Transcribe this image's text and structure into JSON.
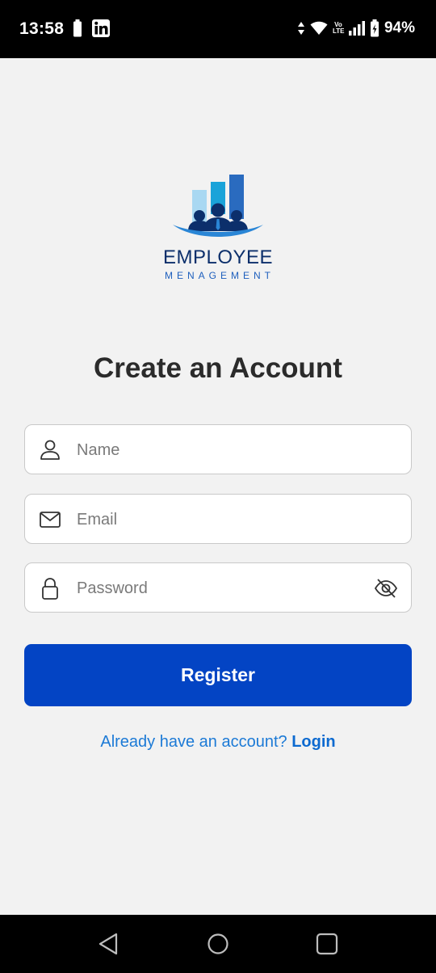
{
  "status_bar": {
    "time": "13:58",
    "battery_percent": "94%",
    "left_icons": [
      "battery-small-icon",
      "linkedin-icon"
    ],
    "right_icons": [
      "data-arrows-icon",
      "wifi-icon",
      "volte-icon",
      "signal-icon",
      "battery-icon"
    ],
    "volte_label": "Vo LTE"
  },
  "logo": {
    "word": "EMPLOYEE",
    "sub": "MENAGEMENT",
    "colors": {
      "dark": "#0c2f6b",
      "light_bar": "#a9d8f2",
      "mid_bar": "#1aa3d9",
      "tall_bar": "#2a6bbf",
      "swoosh": "#2a86d6"
    }
  },
  "page": {
    "title": "Create an Account"
  },
  "form": {
    "name": {
      "placeholder": "Name",
      "value": "",
      "icon": "person-icon"
    },
    "email": {
      "placeholder": "Email",
      "value": "",
      "icon": "mail-icon"
    },
    "password": {
      "placeholder": "Password",
      "value": "",
      "icon": "lock-icon",
      "toggle_icon": "eye-off-icon"
    }
  },
  "register_button": {
    "label": "Register",
    "color": "#0344c4"
  },
  "login_prompt": {
    "text": "Already have an account? ",
    "link": "Login",
    "color": "#1c7ad6"
  },
  "nav_bar": {
    "buttons": [
      "back-icon",
      "home-icon",
      "recents-icon"
    ]
  }
}
